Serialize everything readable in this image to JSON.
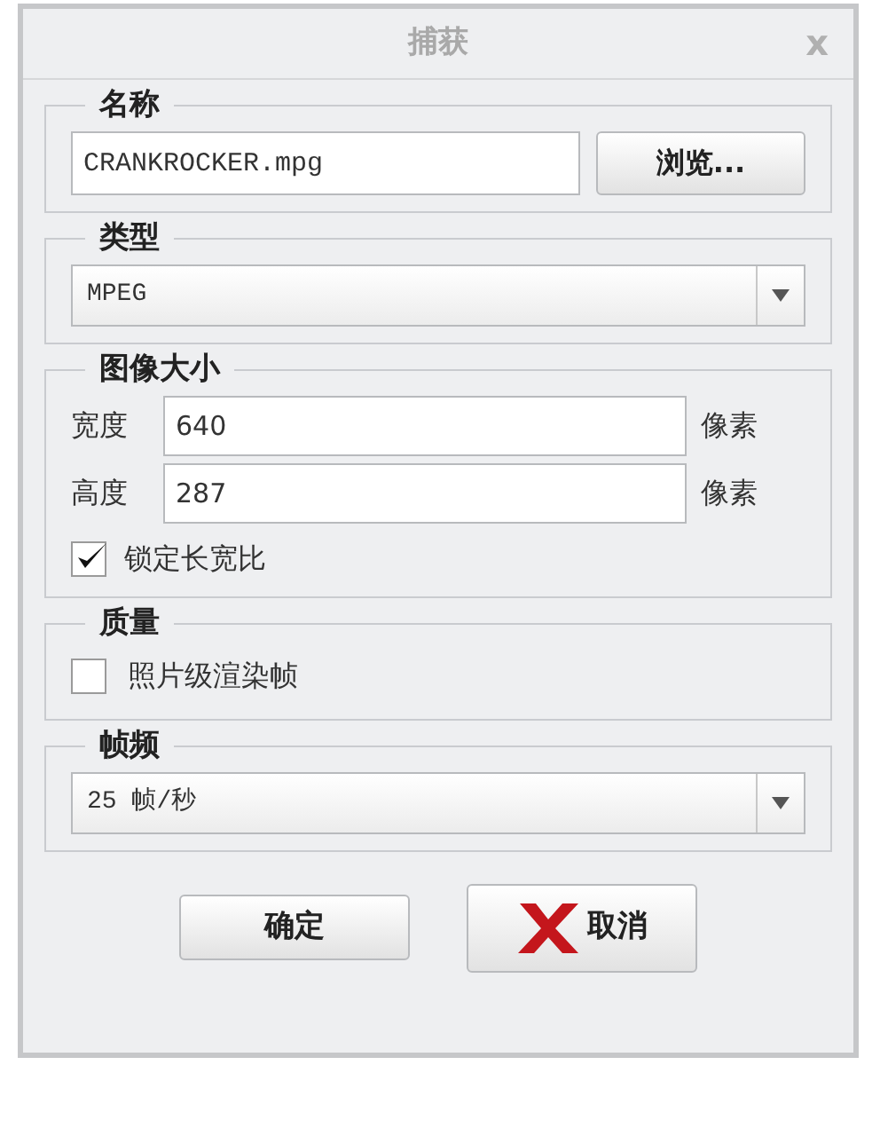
{
  "window": {
    "title": "捕获",
    "close": "x"
  },
  "name_group": {
    "legend": "名称",
    "value": "CRANKROCKER.mpg",
    "browse": "浏览..."
  },
  "type_group": {
    "legend": "类型",
    "value": "MPEG"
  },
  "size_group": {
    "legend": "图像大小",
    "rows": [
      {
        "label": "宽度",
        "value": "640",
        "unit": "像素"
      },
      {
        "label": "高度",
        "value": "287",
        "unit": "像素"
      }
    ],
    "lock": {
      "label": "锁定长宽比",
      "checked": true
    }
  },
  "quality_group": {
    "legend": "质量",
    "option": {
      "label": "照片级渲染帧",
      "checked": false
    }
  },
  "rate_group": {
    "legend": "帧频",
    "value": "25 帧/秒"
  },
  "buttons": [
    {
      "kind": "ok",
      "label": "确定"
    },
    {
      "kind": "cancel",
      "label": "取消"
    }
  ]
}
